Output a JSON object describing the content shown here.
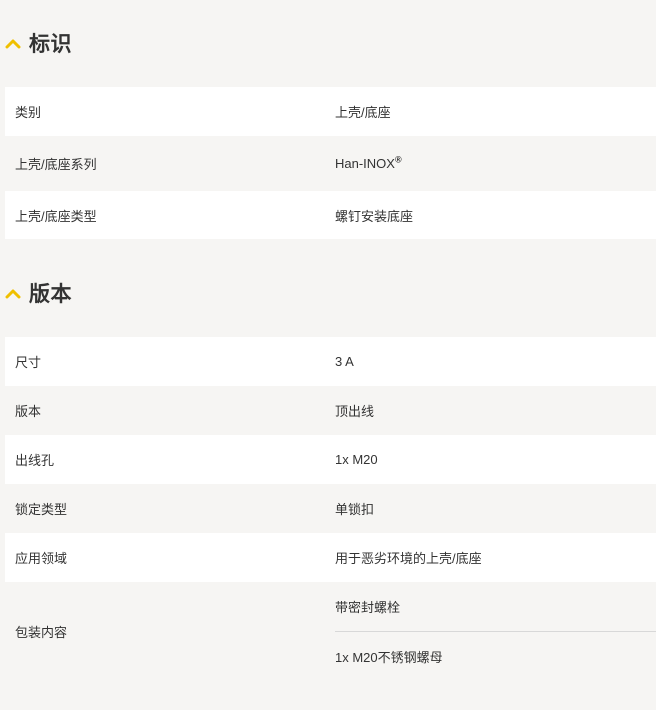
{
  "colors": {
    "accent": "#f0c000",
    "row_white": "#ffffff",
    "row_alt": "#f6f5f3",
    "text": "#333333"
  },
  "sections": {
    "identification": {
      "title": "标识",
      "icon": "chevron-up-icon",
      "rows": [
        {
          "label": "类别",
          "value": "上壳/底座"
        },
        {
          "label": "上壳/底座系列",
          "value": "Han-INOX",
          "value_sup": "®"
        },
        {
          "label": "上壳/底座类型",
          "value": "螺钉安装底座"
        }
      ]
    },
    "version": {
      "title": "版本",
      "icon": "chevron-up-icon",
      "rows": [
        {
          "label": "尺寸",
          "value": "3 A"
        },
        {
          "label": "版本",
          "value": "顶出线"
        },
        {
          "label": "出线孔",
          "value": "1x M20"
        },
        {
          "label": "锁定类型",
          "value": "单锁扣"
        },
        {
          "label": "应用领域",
          "value": "用于恶劣环境的上壳/底座"
        },
        {
          "label": "包装内容",
          "values": [
            "带密封螺栓",
            "1x M20不锈钢螺母"
          ]
        }
      ]
    }
  }
}
